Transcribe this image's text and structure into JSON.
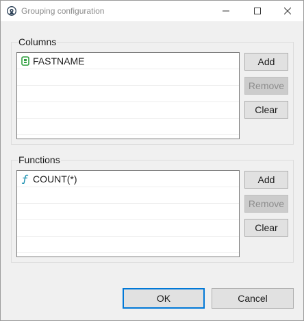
{
  "window": {
    "title": "Grouping configuration",
    "icon": "app-gear-icon",
    "controls": [
      "minimize-icon",
      "maximize-icon",
      "close-icon"
    ]
  },
  "columns": {
    "label": "Columns",
    "items": [
      {
        "text": "FASTNAME",
        "icon": "column-icon",
        "icon_color": "#2e9e3e"
      }
    ],
    "add_label": "Add",
    "remove_label": "Remove",
    "clear_label": "Clear"
  },
  "functions": {
    "label": "Functions",
    "items": [
      {
        "text": "COUNT(*)",
        "icon": "function-icon",
        "icon_color": "#1a8fb0"
      }
    ],
    "add_label": "Add",
    "remove_label": "Remove",
    "clear_label": "Clear"
  },
  "footer": {
    "ok_label": "OK",
    "cancel_label": "Cancel"
  },
  "colors": {
    "accent": "#0078d7"
  }
}
